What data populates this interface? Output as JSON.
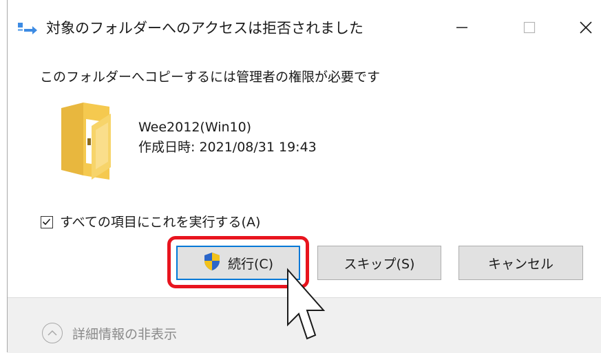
{
  "window": {
    "title": "対象のフォルダーへのアクセスは拒否されました",
    "minimize_glyph": "—",
    "maximize_glyph": "☐",
    "close_glyph": "✕"
  },
  "dialog": {
    "heading": "このフォルダーへコピーするには管理者の権限が必要です",
    "item": {
      "name": "Wee2012(Win10)",
      "created": "作成日時: 2021/08/31 19:43",
      "icon": "folder-icon"
    },
    "checkbox": {
      "label": "すべての項目にこれを実行する(A)",
      "checked": true
    },
    "buttons": {
      "continue_label": "続行(C)",
      "skip_label": "スキップ(S)",
      "cancel_label": "キャンセル"
    },
    "footer": {
      "details_label": "詳細情報の非表示"
    }
  },
  "colors": {
    "highlight": "#e8141e",
    "focus": "#0078d7",
    "button_bg": "#e1e1e1",
    "folder": "#f5c94f"
  }
}
